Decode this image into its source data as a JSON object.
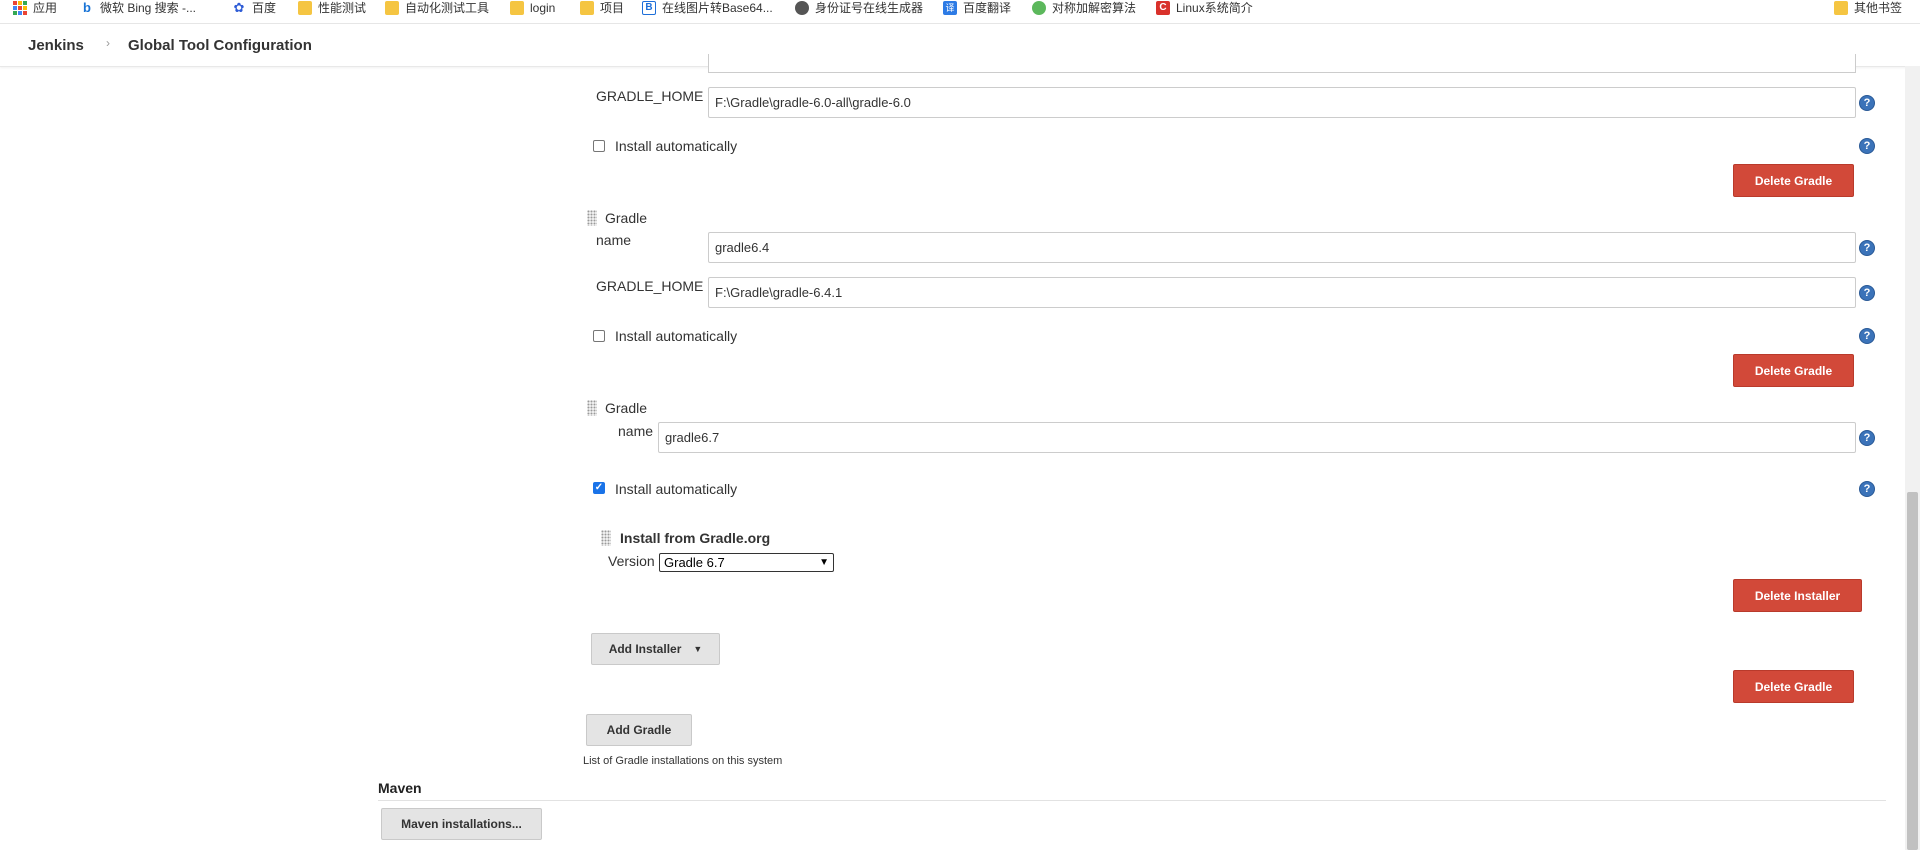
{
  "bookmarks": [
    {
      "label": "应用",
      "icon": "apps-grid-icon"
    },
    {
      "label": "微软 Bing 搜索 -...",
      "icon": "bing-icon"
    },
    {
      "label": "百度",
      "icon": "baidu-paw-icon"
    },
    {
      "label": "性能测试",
      "icon": "folder-icon"
    },
    {
      "label": "自动化测试工具",
      "icon": "folder-icon"
    },
    {
      "label": "login",
      "icon": "folder-icon"
    },
    {
      "label": "项目",
      "icon": "folder-icon"
    },
    {
      "label": "在线图片转Base64...",
      "icon": "base64-site-icon"
    },
    {
      "label": "身份证号在线生成器",
      "icon": "globe-icon"
    },
    {
      "label": "百度翻译",
      "icon": "baidu-translate-icon"
    },
    {
      "label": "对称加解密算法",
      "icon": "site-icon"
    },
    {
      "label": "Linux系统简介",
      "icon": "csdn-icon"
    }
  ],
  "other_bookmarks": "其他书签",
  "breadcrumb": {
    "root": "Jenkins",
    "page": "Global Tool Configuration"
  },
  "gradle_1": {
    "home_label": "GRADLE_HOME",
    "home_value": "F:\\Gradle\\gradle-6.0-all\\gradle-6.0",
    "install_auto_label": "Install automatically",
    "install_auto_checked": false,
    "delete_label": "Delete Gradle"
  },
  "gradle_2": {
    "header": "Gradle",
    "name_label": "name",
    "name_value": "gradle6.4",
    "home_label": "GRADLE_HOME",
    "home_value": "F:\\Gradle\\gradle-6.4.1",
    "install_auto_label": "Install automatically",
    "install_auto_checked": false,
    "delete_label": "Delete Gradle"
  },
  "gradle_3": {
    "header": "Gradle",
    "name_label": "name",
    "name_value": "gradle6.7",
    "install_auto_label": "Install automatically",
    "install_auto_checked": true,
    "installer": {
      "title": "Install from Gradle.org",
      "version_label": "Version",
      "version_selected": "Gradle 6.7",
      "delete_installer_label": "Delete Installer"
    },
    "add_installer_label": "Add Installer",
    "delete_label": "Delete Gradle"
  },
  "add_gradle_label": "Add Gradle",
  "gradle_list_note": "List of Gradle installations on this system",
  "maven": {
    "title": "Maven",
    "installations_button": "Maven installations..."
  },
  "help_glyph": "?",
  "colors": {
    "delete_red": "#d24939",
    "help_blue": "#3b73b9",
    "checkbox_blue": "#1a73e8"
  }
}
